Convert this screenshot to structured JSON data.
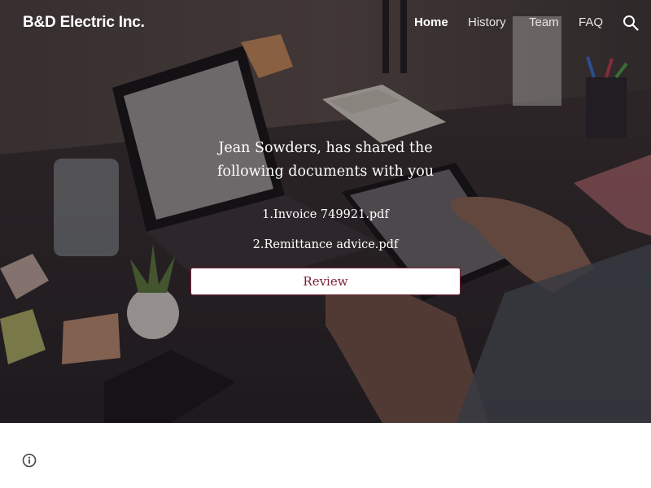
{
  "site": {
    "title": "B&D Electric Inc."
  },
  "nav": {
    "items": [
      {
        "label": "Home",
        "active": true
      },
      {
        "label": "History",
        "active": false
      },
      {
        "label": "Team",
        "active": false
      },
      {
        "label": "FAQ",
        "active": false
      }
    ],
    "search_icon": "search-icon"
  },
  "hero": {
    "headline": "Jean Sowders, has shared the following documents with you",
    "documents": [
      "1.Invoice 749921.pdf",
      "2.Remittance advice.pdf"
    ],
    "button_label": "Review"
  },
  "footer": {
    "info_icon": "info-icon"
  },
  "colors": {
    "accent": "#7a2336",
    "text_on_hero": "#ffffff",
    "page_background": "#ffffff"
  }
}
